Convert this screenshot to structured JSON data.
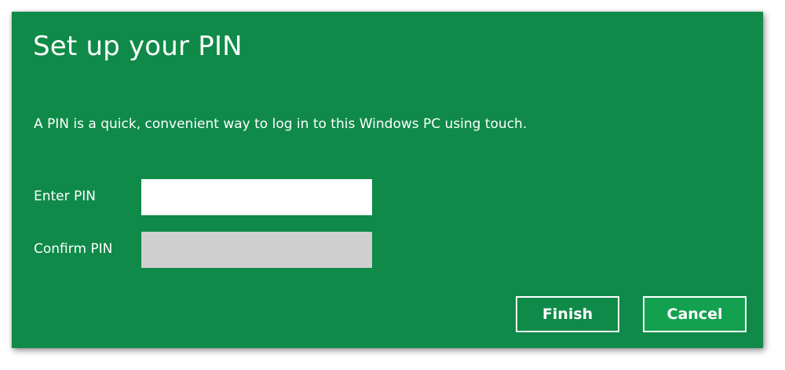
{
  "dialog": {
    "title": "Set up your PIN",
    "description": "A PIN is a quick, convenient way to log in to this Windows PC using touch.",
    "background_color": "#0f8a48"
  },
  "form": {
    "enter_pin": {
      "label": "Enter PIN",
      "value": ""
    },
    "confirm_pin": {
      "label": "Confirm PIN",
      "value": "",
      "state": "disabled"
    }
  },
  "buttons": {
    "finish_label": "Finish",
    "cancel_label": "Cancel"
  }
}
